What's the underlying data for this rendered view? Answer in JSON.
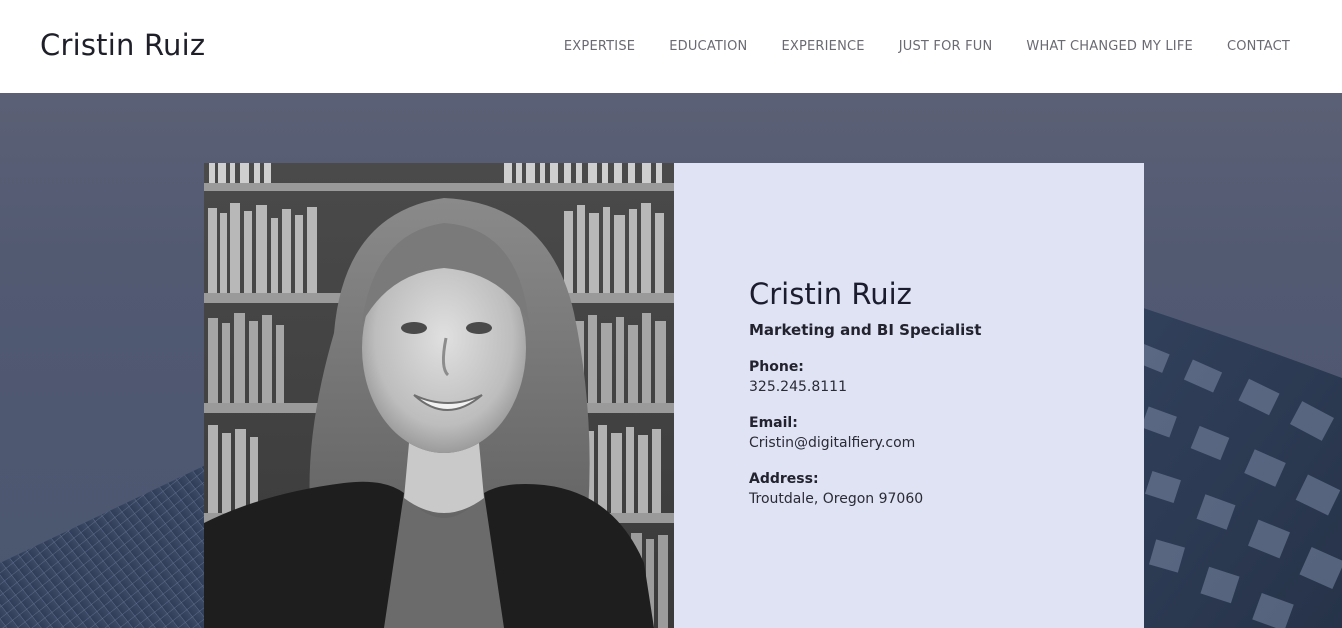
{
  "header": {
    "site_title": "Cristin Ruiz",
    "nav": [
      {
        "label": "EXPERTISE"
      },
      {
        "label": "EDUCATION"
      },
      {
        "label": "EXPERIENCE"
      },
      {
        "label": "JUST FOR FUN"
      },
      {
        "label": "WHAT CHANGED MY LIFE"
      },
      {
        "label": "CONTACT"
      }
    ]
  },
  "profile": {
    "name": "Cristin Ruiz",
    "role": "Marketing and BI Specialist",
    "phone_label": "Phone:",
    "phone": "325.245.8111",
    "email_label": "Email:",
    "email": "Cristin@digitalfiery.com",
    "address_label": "Address:",
    "address": "Troutdale, Oregon 97060"
  },
  "colors": {
    "card_background": "#dfe3f4",
    "hero_background": "#525a72",
    "nav_text": "#6a6a72"
  },
  "images": {
    "portrait": "portrait-photo",
    "background": "skyscraper-background"
  }
}
